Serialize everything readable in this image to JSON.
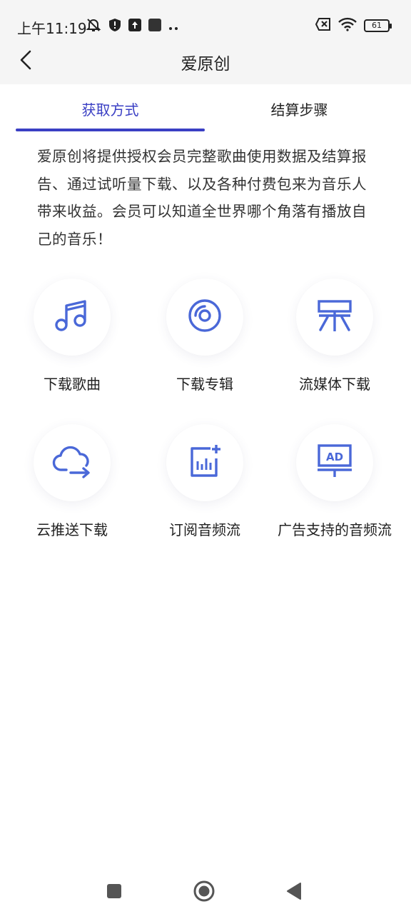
{
  "status_bar": {
    "time": "上午11:19",
    "battery": "61",
    "icons_left": [
      "mute-bell-icon",
      "shield-icon",
      "upload-icon",
      "square-icon",
      "more-dots-icon"
    ],
    "icons_right": [
      "sim-error-icon",
      "wifi-icon",
      "battery-icon"
    ]
  },
  "header": {
    "title": "爱原创",
    "back_icon": "chevron-left-icon"
  },
  "tabs": [
    {
      "label": "获取方式",
      "active": true
    },
    {
      "label": "结算步骤",
      "active": false
    }
  ],
  "accent_color": "#3a3fc4",
  "icon_color": "#4a68d8",
  "description": "爱原创将提供授权会员完整歌曲使用数据及结算报告、通过试听量下载、以及各种付费包来为音乐人带来收益。会员可以知道全世界哪个角落有播放自己的音乐！",
  "methods": [
    {
      "label": "下载歌曲",
      "icon": "music-note-icon"
    },
    {
      "label": "下载专辑",
      "icon": "disc-icon"
    },
    {
      "label": "流媒体下载",
      "icon": "streaming-icon"
    },
    {
      "label": "云推送下载",
      "icon": "cloud-push-icon"
    },
    {
      "label": "订阅音频流",
      "icon": "subscribe-chart-icon"
    },
    {
      "label": "广告支持的音频流",
      "icon": "ad-board-icon"
    }
  ],
  "nav_bar": {
    "icons": [
      "recent-apps-icon",
      "home-icon",
      "back-triangle-icon"
    ]
  }
}
